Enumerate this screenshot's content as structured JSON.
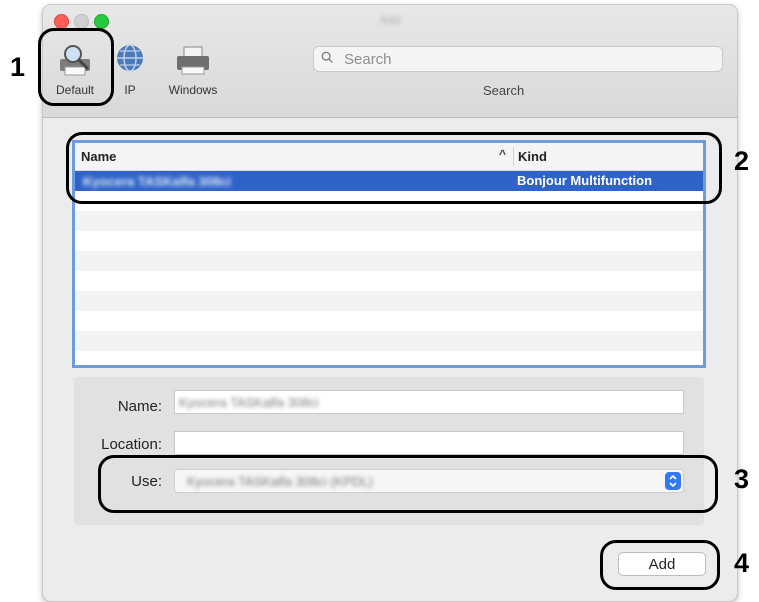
{
  "window": {
    "title": "Add"
  },
  "toolbar": {
    "default_label": "Default",
    "ip_label": "IP",
    "windows_label": "Windows",
    "search_placeholder": "Search",
    "search_caption": "Search"
  },
  "printer_list": {
    "columns": {
      "name": "Name",
      "kind": "Kind",
      "sort_indicator": "^"
    },
    "rows": [
      {
        "name": "Kyocera TASKalfa 308ci",
        "kind": "Bonjour Multifunction"
      }
    ]
  },
  "details": {
    "name_label": "Name:",
    "name_value": "Kyocera TASKalfa 308ci",
    "location_label": "Location:",
    "location_value": "",
    "use_label": "Use:",
    "use_value": "Kyocera TASKalfa 308ci (KPDL)"
  },
  "actions": {
    "add_label": "Add"
  },
  "callouts": {
    "n1": "1",
    "n2": "2",
    "n3": "3",
    "n4": "4"
  },
  "colors": {
    "selection": "#2f63c9",
    "list_border": "#6d9be0",
    "stepper": "#3478f6",
    "close": "#fe5f57",
    "maximize": "#28c840"
  }
}
